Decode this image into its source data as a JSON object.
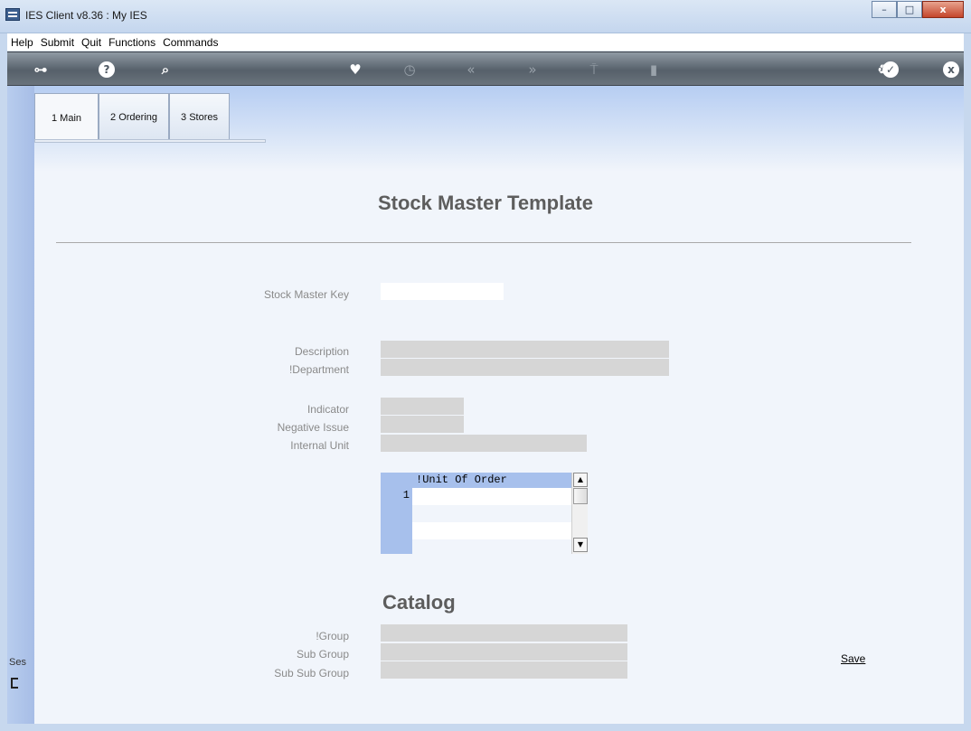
{
  "window": {
    "title": "IES Client v8.36 : My IES",
    "minimize": "–",
    "maximize": "□",
    "close": "x"
  },
  "menu": [
    "Help",
    "Submit",
    "Quit",
    "Functions",
    "Commands"
  ],
  "toolbar_icons": [
    "key-icon",
    "help-icon",
    "search-icon",
    "heart-icon",
    "clock-icon",
    "rewind-icon",
    "fast-forward-icon",
    "pin-icon",
    "copy-icon",
    "recycle-icon",
    "check-icon",
    "close-icon"
  ],
  "tabs": [
    {
      "label": "1 Main"
    },
    {
      "label": "2 Ordering"
    },
    {
      "label": "3 Stores"
    }
  ],
  "page_title": "Stock Master Template",
  "fields": {
    "stock_master_key": {
      "label": "Stock Master Key",
      "value": ""
    },
    "description": {
      "label": "Description",
      "value": ""
    },
    "department": {
      "label": "!Department",
      "value": ""
    },
    "indicator": {
      "label": "Indicator",
      "value": ""
    },
    "negative_issue": {
      "label": "Negative Issue",
      "value": ""
    },
    "internal_unit": {
      "label": "Internal Unit",
      "value": ""
    }
  },
  "grid": {
    "header": "!Unit Of Order",
    "row_number": "1"
  },
  "catalog": {
    "title": "Catalog",
    "group": {
      "label": "!Group",
      "value": ""
    },
    "sub_group": {
      "label": "Sub Group",
      "value": ""
    },
    "sub_sub_group": {
      "label": "Sub Sub Group",
      "value": ""
    }
  },
  "save_label": "Save",
  "side_label": "Ses"
}
